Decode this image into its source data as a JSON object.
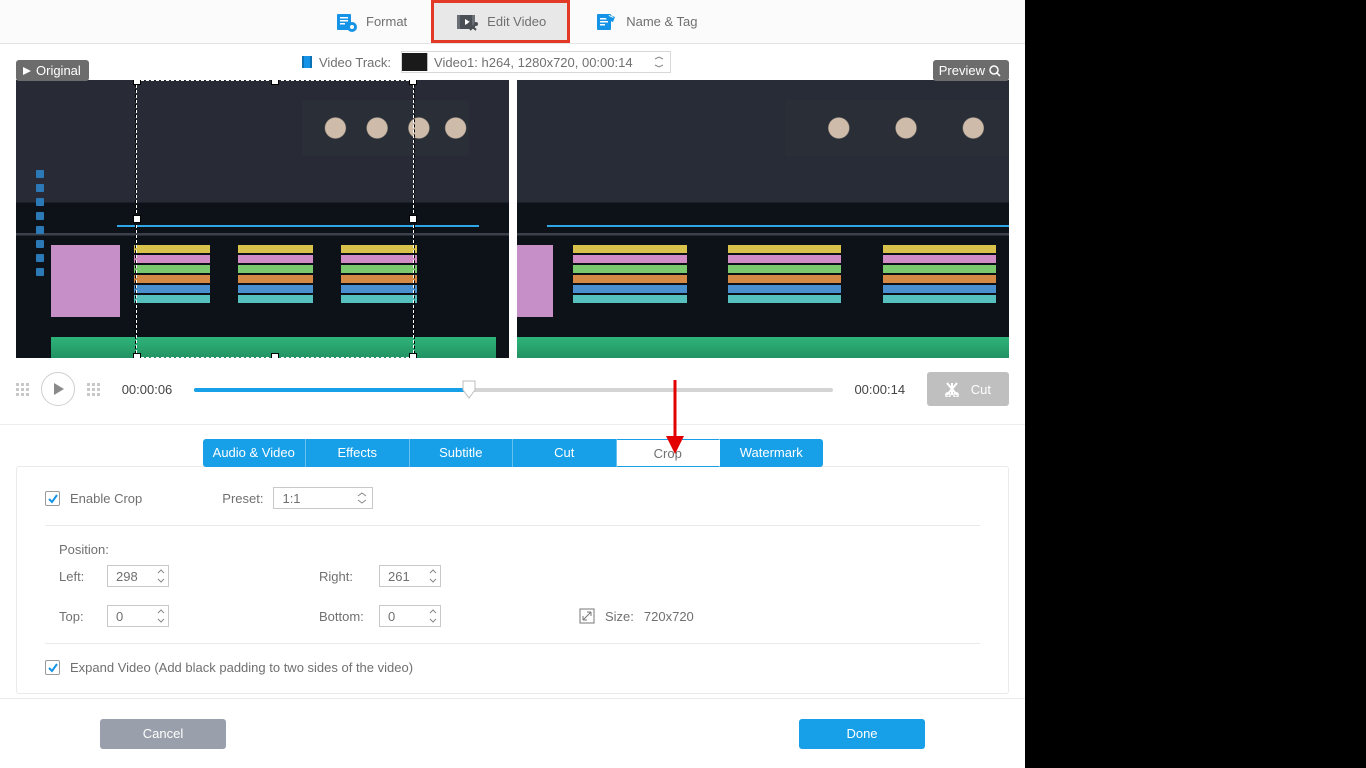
{
  "toptabs": {
    "format": "Format",
    "editvideo": "Edit Video",
    "nametag": "Name & Tag"
  },
  "badges": {
    "original": "Original",
    "preview": "Preview"
  },
  "video_track": {
    "label": "Video Track:",
    "selected": "Video1: h264, 1280x720, 00:00:14"
  },
  "playback": {
    "current": "00:00:06",
    "total": "00:00:14",
    "cut_label": "Cut"
  },
  "settings_tabs": {
    "av": "Audio & Video",
    "effects": "Effects",
    "subtitle": "Subtitle",
    "cut": "Cut",
    "crop": "Crop",
    "watermark": "Watermark"
  },
  "crop": {
    "enable_label": "Enable Crop",
    "enable_checked": true,
    "preset_label": "Preset:",
    "preset_value": "1:1",
    "position_label": "Position:",
    "left_label": "Left:",
    "left_value": "298",
    "right_label": "Right:",
    "right_value": "261",
    "top_label": "Top:",
    "top_value": "0",
    "bottom_label": "Bottom:",
    "bottom_value": "0",
    "size_label": "Size:",
    "size_value": "720x720",
    "expand_label": "Expand Video (Add black padding to two sides of the video)",
    "expand_checked": true
  },
  "footer": {
    "cancel": "Cancel",
    "done": "Done"
  }
}
